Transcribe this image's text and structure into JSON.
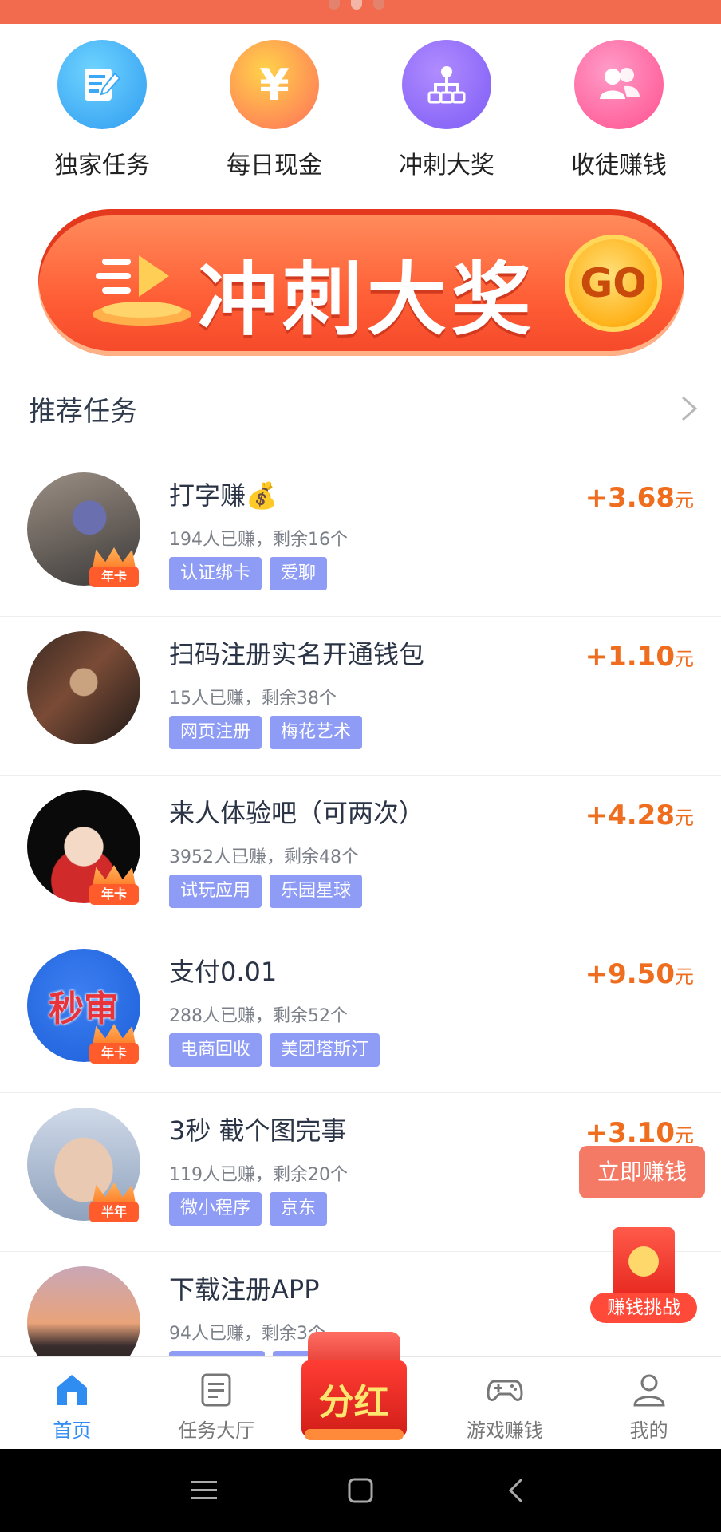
{
  "quick_menu": [
    {
      "label": "独家任务",
      "icon": "edit-note-icon",
      "color": "#3aa8f4"
    },
    {
      "label": "每日现金",
      "icon": "yuan-icon",
      "color": "#ff8a4f"
    },
    {
      "label": "冲刺大奖",
      "icon": "hierarchy-icon",
      "color": "#8a67f7"
    },
    {
      "label": "收徒赚钱",
      "icon": "people-icon",
      "color": "#ff5f97"
    }
  ],
  "banner": {
    "title": "冲刺大奖",
    "go_label": "GO"
  },
  "section": {
    "title": "推荐任务"
  },
  "tasks": [
    {
      "title": "打字赚💰",
      "stats": "194人已赚，剩余16个",
      "tags": [
        "认证绑卡",
        "爱聊"
      ],
      "reward": "+3.68",
      "unit": "元",
      "badge": "年卡"
    },
    {
      "title": "扫码注册实名开通钱包",
      "stats": "15人已赚，剩余38个",
      "tags": [
        "网页注册",
        "梅花艺术"
      ],
      "reward": "+1.10",
      "unit": "元",
      "badge": ""
    },
    {
      "title": "来人体验吧（可两次）",
      "stats": "3952人已赚，剩余48个",
      "tags": [
        "试玩应用",
        "乐园星球"
      ],
      "reward": "+4.28",
      "unit": "元",
      "badge": "年卡"
    },
    {
      "title": "支付0.01",
      "stats": "288人已赚，剩余52个",
      "tags": [
        "电商回收",
        "美团塔斯汀"
      ],
      "reward": "+9.50",
      "unit": "元",
      "badge": "年卡",
      "avatar_text": "秒审"
    },
    {
      "title": "3秒 截个图完事",
      "stats": "119人已赚，剩余20个",
      "tags": [
        "微小程序",
        "京东"
      ],
      "reward": "+3.10",
      "unit": "元",
      "badge": "半年"
    },
    {
      "title": "下载注册APP",
      "stats": "94人已赚，剩余3个",
      "tags": [
        "",
        ""
      ],
      "reward": "",
      "unit": "",
      "badge": ""
    }
  ],
  "floating": {
    "earn_now": "立即赚钱",
    "challenge": "赚钱挑战"
  },
  "tabbar": [
    {
      "label": "首页",
      "icon": "home-icon",
      "active": true
    },
    {
      "label": "任务大厅",
      "icon": "task-list-icon",
      "active": false
    },
    {
      "label": "",
      "icon": "dividend-bag-icon",
      "badge_text": "分红",
      "active": false
    },
    {
      "label": "游戏赚钱",
      "icon": "gamepad-icon",
      "active": false
    },
    {
      "label": "我的",
      "icon": "user-icon",
      "active": false
    }
  ]
}
